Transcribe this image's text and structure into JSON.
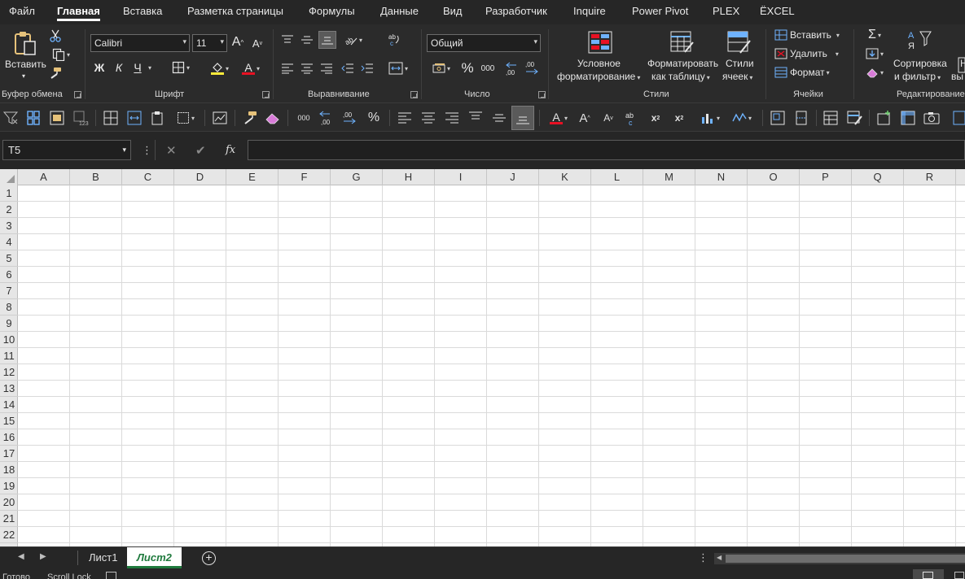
{
  "menu": {
    "tabs": [
      "Файл",
      "Главная",
      "Вставка",
      "Разметка страницы",
      "Формулы",
      "Данные",
      "Вид",
      "Разработчик",
      "Inquire",
      "Power Pivot",
      "PLEX",
      "ЁXCEL"
    ],
    "active": "Главная"
  },
  "ribbon": {
    "clipboard": {
      "paste_label": "Вставить",
      "group_label": "Буфер обмена"
    },
    "font": {
      "name": "Calibri",
      "size": "11",
      "bold": "Ж",
      "italic": "К",
      "underline": "Ч",
      "grow": "A",
      "shrink": "A",
      "font_color_glyph": "A",
      "group_label": "Шрифт"
    },
    "alignment": {
      "group_label": "Выравнивание"
    },
    "number": {
      "format": "Общий",
      "percent": "%",
      "thousands": "000",
      "group_label": "Число"
    },
    "styles": {
      "conditional_l1": "Условное",
      "conditional_l2": "форматирование",
      "as_table_l1": "Форматировать",
      "as_table_l2": "как таблицу",
      "cell_styles_l1": "Стили",
      "cell_styles_l2": "ячеек",
      "group_label": "Стили"
    },
    "cells": {
      "insert": "Вставить",
      "delete": "Удалить",
      "format": "Формат",
      "group_label": "Ячейки"
    },
    "editing": {
      "sort_l1": "Сортировка",
      "sort_l2": "и фильтр",
      "find_l1": "Н",
      "find_l2": "вы",
      "group_label": "Редактирование"
    }
  },
  "formula_bar": {
    "name_box": "T5",
    "fx": "fx",
    "value": ""
  },
  "grid": {
    "columns": [
      "A",
      "B",
      "C",
      "D",
      "E",
      "F",
      "G",
      "H",
      "I",
      "J",
      "K",
      "L",
      "M",
      "N",
      "O",
      "P",
      "Q",
      "R"
    ],
    "rows": [
      "1",
      "2",
      "3",
      "4",
      "5",
      "6",
      "7",
      "8",
      "9",
      "10",
      "11",
      "12",
      "13",
      "14",
      "15",
      "16",
      "17",
      "18",
      "19",
      "20",
      "21",
      "22"
    ]
  },
  "sheets": {
    "tabs": [
      "Лист1",
      "Лист2"
    ],
    "active": "Лист2",
    "add": "+"
  },
  "status": {
    "ready": "Готово",
    "scroll_lock": "Scroll Lock"
  },
  "colors": {
    "accent_green": "#1f7a3d",
    "font_red": "#e81123",
    "fill_yellow": "#ffeb3b"
  }
}
